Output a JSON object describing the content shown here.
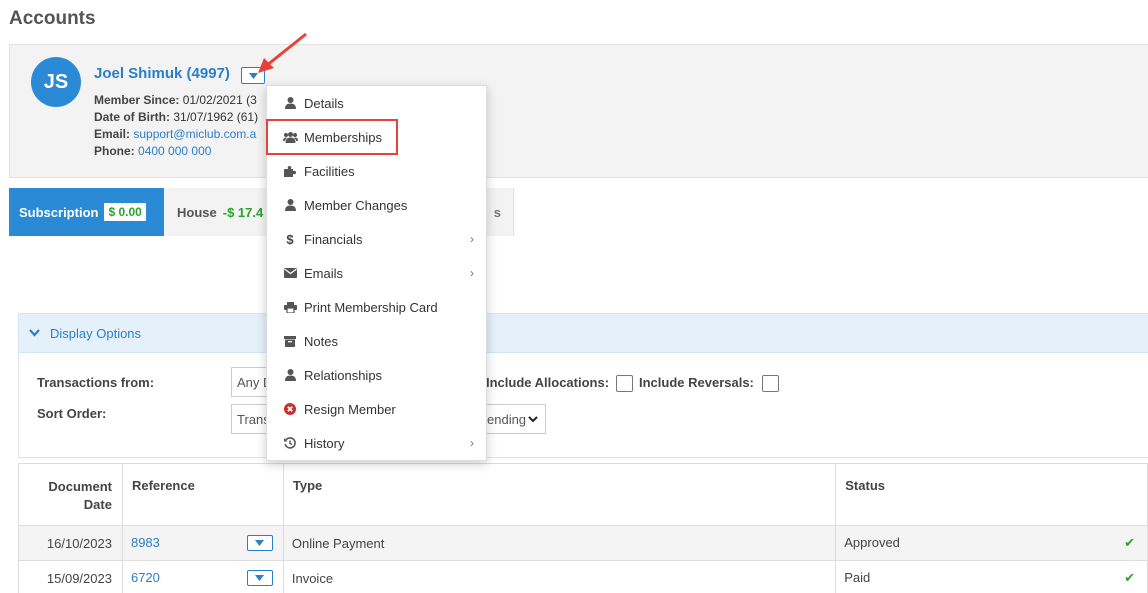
{
  "page": {
    "title": "Accounts"
  },
  "member": {
    "initials": "JS",
    "name": "Joel Shimuk (4997)",
    "member_since_label": "Member Since:",
    "member_since_value": "01/02/2021 (3",
    "dob_label": "Date of Birth:",
    "dob_value": "31/07/1962 (61)",
    "email_label": "Email:",
    "email_value": "support@miclub.com.a",
    "phone_label": "Phone:",
    "phone_value": "0400 000 000"
  },
  "tabs": {
    "subscription_label": "Subscription",
    "subscription_amount": "$ 0.00",
    "house_label": "House",
    "house_amount": "-$ 17.4",
    "house_more": "s"
  },
  "display_options": {
    "label": "Display Options"
  },
  "filters": {
    "transactions_from_label": "Transactions from:",
    "transactions_from_value": "Any D",
    "sort_order_label": "Sort Order:",
    "sort_order_value": "Trans",
    "include_allocations_label": "Include Allocations:",
    "include_reversals_label": "Include Reversals:",
    "order_value": "ending"
  },
  "table": {
    "headers": {
      "doc_date_line1": "Document",
      "doc_date_line2": "Date",
      "reference": "Reference",
      "type": "Type",
      "status": "Status"
    },
    "rows": [
      {
        "date": "16/10/2023",
        "reference": "8983",
        "type": "Online Payment",
        "status": "Approved"
      },
      {
        "date": "15/09/2023",
        "reference": "6720",
        "type": "Invoice",
        "status": "Paid"
      }
    ]
  },
  "menu": {
    "items": [
      {
        "label": "Details",
        "icon": "user-icon",
        "submenu": false
      },
      {
        "label": "Memberships",
        "icon": "users-icon",
        "submenu": false
      },
      {
        "label": "Facilities",
        "icon": "puzzle-icon",
        "submenu": false
      },
      {
        "label": "Member Changes",
        "icon": "user-icon",
        "submenu": false
      },
      {
        "label": "Financials",
        "icon": "dollar-icon",
        "submenu": true
      },
      {
        "label": "Emails",
        "icon": "envelope-icon",
        "submenu": true
      },
      {
        "label": "Print Membership Card",
        "icon": "print-icon",
        "submenu": false
      },
      {
        "label": "Notes",
        "icon": "archive-icon",
        "submenu": false
      },
      {
        "label": "Relationships",
        "icon": "user-icon",
        "submenu": false
      },
      {
        "label": "Resign Member",
        "icon": "times-circle-icon",
        "submenu": false
      },
      {
        "label": "History",
        "icon": "history-icon",
        "submenu": true
      }
    ]
  },
  "colors": {
    "accent": "#2b8ad6",
    "link": "#2b7fc8",
    "positive": "#2aa32a",
    "annotation": "#e8403a"
  }
}
